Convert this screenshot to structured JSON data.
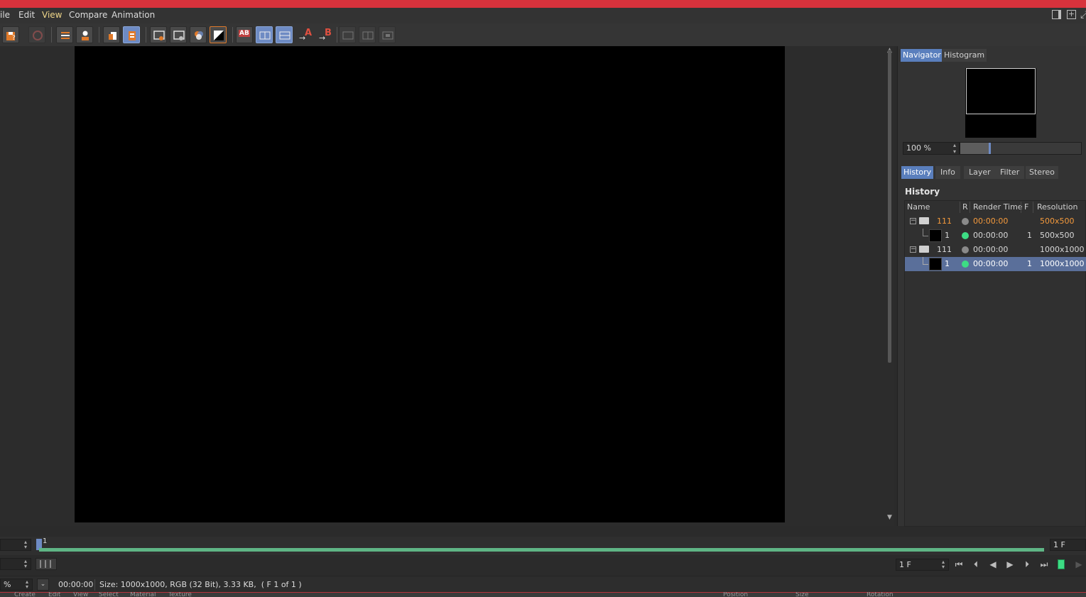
{
  "menubar": {
    "items": [
      "ile",
      "Edit",
      "View",
      "Compare",
      "Animation"
    ],
    "active": "View"
  },
  "toolbar": {
    "buttons": [
      {
        "name": "save-icon",
        "state": "normal"
      },
      {
        "name": "disabled-icon",
        "state": "dim"
      },
      {
        "name": "align-icon",
        "state": "normal"
      },
      {
        "name": "person-icon",
        "state": "normal"
      },
      {
        "name": "copy-icon",
        "state": "normal"
      },
      {
        "name": "paste-icon",
        "state": "on"
      },
      {
        "name": "view-icon",
        "state": "normal"
      },
      {
        "name": "view-alt-icon",
        "state": "normal"
      },
      {
        "name": "channels-icon",
        "state": "normal"
      },
      {
        "name": "contrast-icon",
        "state": "normal"
      },
      {
        "name": "ab-icon",
        "state": "normal"
      },
      {
        "name": "ab-split-icon",
        "state": "on"
      },
      {
        "name": "ab-wipe-icon",
        "state": "on"
      },
      {
        "name": "set-a-icon",
        "state": "normal"
      },
      {
        "name": "set-b-icon",
        "state": "normal"
      },
      {
        "name": "compare-1-icon",
        "state": "dim"
      },
      {
        "name": "compare-2-icon",
        "state": "dim"
      },
      {
        "name": "compare-3-icon",
        "state": "dim"
      }
    ],
    "set_a_label": "A",
    "set_b_label": "B",
    "ab_label": "AB"
  },
  "navigator": {
    "tabs": [
      "Navigator",
      "Histogram"
    ],
    "active_tab": "Navigator",
    "zoom": "100 %",
    "zoom_level_fraction": 0.25
  },
  "panel_tabs": {
    "tabs": [
      "History",
      "Info",
      "Layer",
      "Filter",
      "Stereo"
    ],
    "active_tab": "History"
  },
  "history": {
    "title": "History",
    "columns": [
      "Name",
      "R",
      "Render Time",
      "F",
      "Resolution"
    ],
    "rows": [
      {
        "name": "111",
        "render_time": "00:00:00",
        "f": "",
        "resolution": "500x500",
        "type": "folder",
        "dot": "#8a8a8a",
        "highlight": true,
        "selected": false
      },
      {
        "name": "1",
        "render_time": "00:00:00",
        "f": "1",
        "resolution": "500x500",
        "type": "image",
        "dot": "#3ddc84",
        "highlight": false,
        "selected": false
      },
      {
        "name": "111",
        "render_time": "00:00:00",
        "f": "",
        "resolution": "1000x1000",
        "type": "folder",
        "dot": "#8a8a8a",
        "highlight": false,
        "selected": false
      },
      {
        "name": "1",
        "render_time": "00:00:00",
        "f": "1",
        "resolution": "1000x1000",
        "type": "image",
        "dot": "#3ddc84",
        "highlight": false,
        "selected": true
      }
    ]
  },
  "timeline": {
    "frame_marker": "1",
    "end_frame": "1 F",
    "current_frame": "1 F"
  },
  "status": {
    "zoom_partial": "%",
    "time": "00:00:00",
    "info": "Size: 1000x1000, RGB (32 Bit), 3.33 KB,  ( F 1 of 1 )"
  },
  "bottom_menu": {
    "items": [
      "Create",
      "Edit",
      "View",
      "Select",
      "Material",
      "Texture"
    ],
    "right_items": [
      "Position",
      "Size",
      "Rotation"
    ]
  },
  "colors": {
    "accent": "#5a7fbd",
    "title_strip": "#d8323c",
    "timeline": "#5fb585",
    "highlight_text": "#f59a3c"
  }
}
